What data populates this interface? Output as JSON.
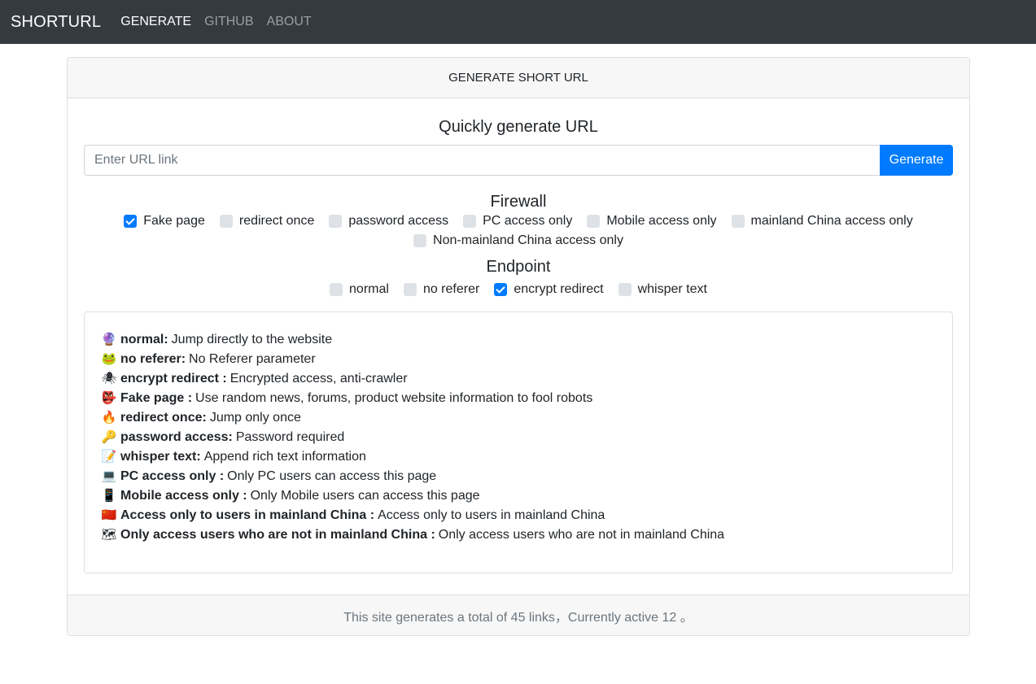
{
  "nav": {
    "brand": "SHORTURL",
    "links": [
      {
        "label": "GENERATE"
      },
      {
        "label": "GITHUB"
      },
      {
        "label": "ABOUT"
      }
    ]
  },
  "card": {
    "header": "GENERATE SHORT URL",
    "quick_title": "Quickly generate URL",
    "url_placeholder": "Enter URL link",
    "url_value": "",
    "generate_label": "Generate",
    "firewall_title": "Firewall",
    "firewall_options": [
      {
        "label": "Fake page",
        "checked": true
      },
      {
        "label": "redirect once",
        "checked": false
      },
      {
        "label": "password access",
        "checked": false
      },
      {
        "label": "PC access only",
        "checked": false
      },
      {
        "label": "Mobile access only",
        "checked": false
      },
      {
        "label": "mainland China access only",
        "checked": false
      },
      {
        "label": "Non-mainland China access only",
        "checked": false
      }
    ],
    "endpoint_title": "Endpoint",
    "endpoint_options": [
      {
        "label": "normal",
        "checked": false
      },
      {
        "label": "no referer",
        "checked": false
      },
      {
        "label": "encrypt redirect",
        "checked": true
      },
      {
        "label": "whisper text",
        "checked": false
      }
    ],
    "info": [
      {
        "icon": "🔮",
        "term": "normal:",
        "desc": "Jump directly to the website"
      },
      {
        "icon": "🐸",
        "term": "no referer:",
        "desc": "No Referer parameter"
      },
      {
        "icon": "🕷",
        "term": "encrypt redirect :",
        "desc": "Encrypted access, anti-crawler"
      },
      {
        "icon": "👺",
        "term": "Fake page :",
        "desc": "Use random news, forums, product website information to fool robots"
      },
      {
        "icon": "🔥",
        "term": "redirect once:",
        "desc": "Jump only once"
      },
      {
        "icon": "🔑",
        "term": "password access:",
        "desc": "Password required"
      },
      {
        "icon": "📝",
        "term": "whisper text:",
        "desc": "Append rich text information"
      },
      {
        "icon": "💻",
        "term": "PC access only :",
        "desc": "Only PC users can access this page"
      },
      {
        "icon": "📱",
        "term": "Mobile access only :",
        "desc": "Only Mobile users can access this page"
      },
      {
        "icon": "🇨🇳",
        "term": "Access only to users in mainland China :",
        "desc": "Access only to users in mainland China"
      },
      {
        "icon": "🗺",
        "term": "Only access users who are not in mainland China :",
        "desc": "Only access users who are not in mainland China"
      }
    ],
    "footer": "This site generates a total of 45 links，Currently active 12 。"
  },
  "colors": {
    "navbar": "#343a40",
    "primary": "#007bff",
    "header_bg": "#f7f7f7"
  }
}
